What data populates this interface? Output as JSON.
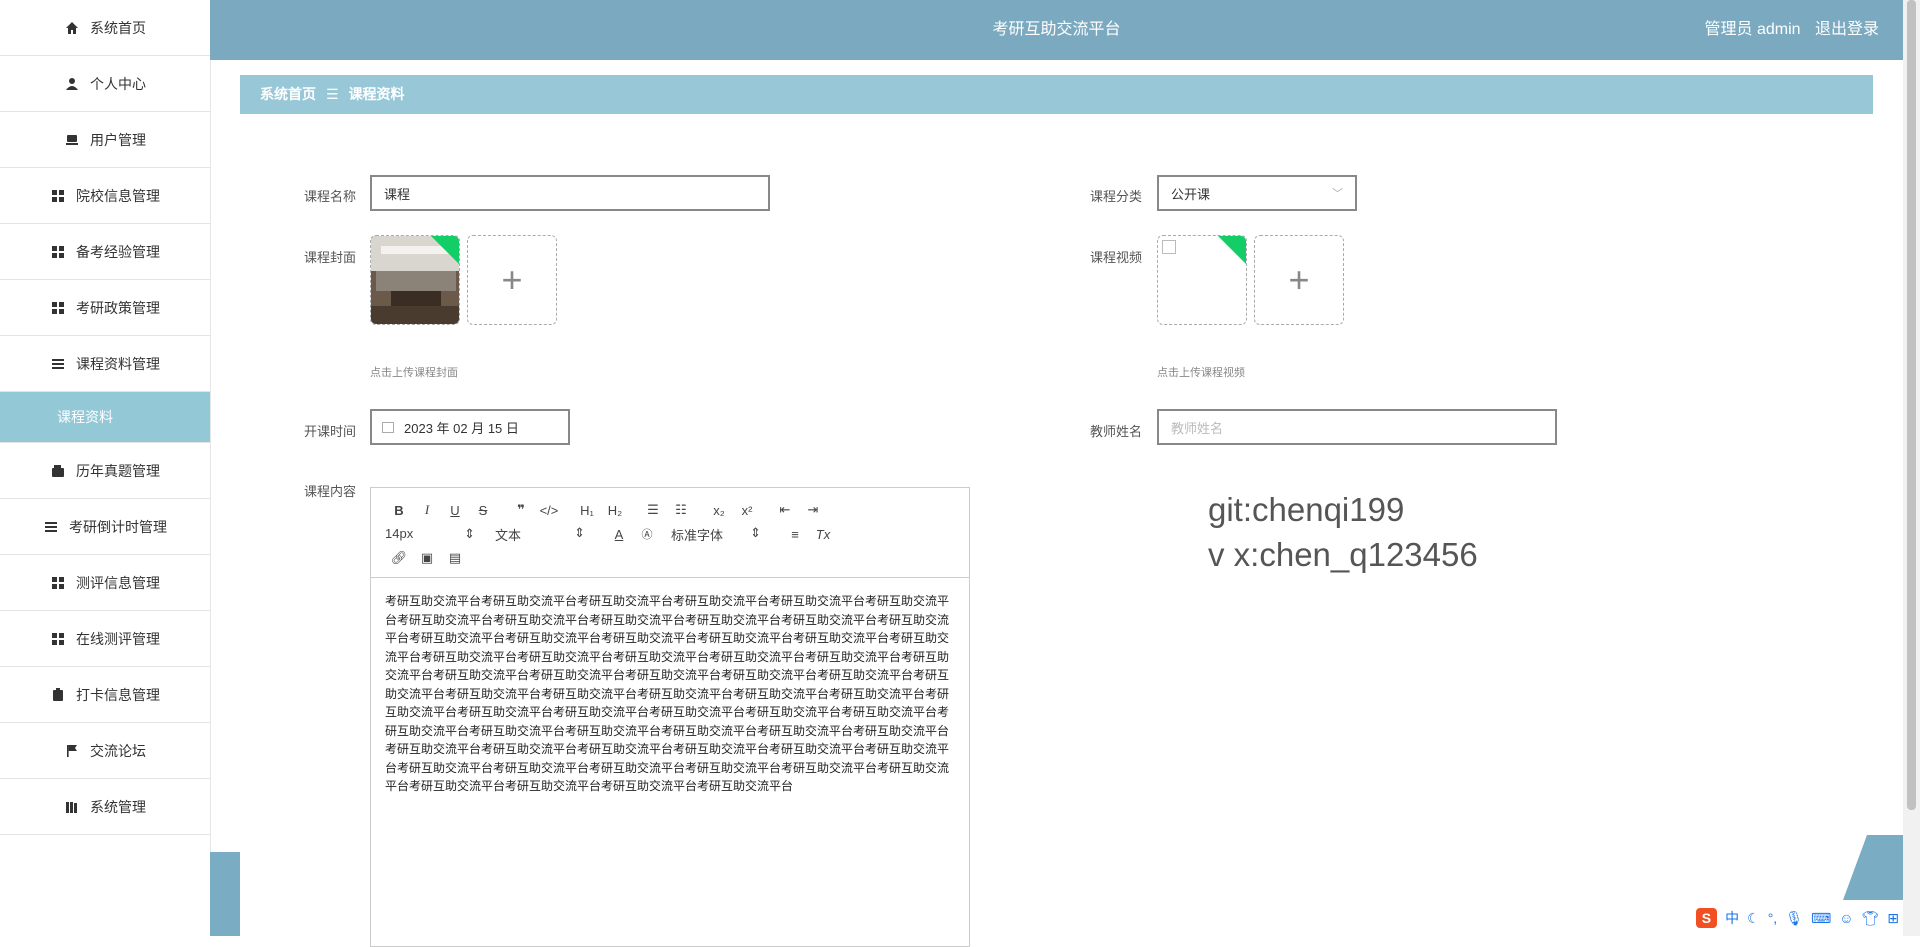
{
  "header": {
    "title": "考研互助交流平台",
    "user": "管理员 admin",
    "logout": "退出登录"
  },
  "sidebar": {
    "items": [
      {
        "label": "系统首页",
        "icon": "home-icon"
      },
      {
        "label": "个人中心",
        "icon": "user-icon"
      },
      {
        "label": "用户管理",
        "icon": "users-icon"
      },
      {
        "label": "院校信息管理",
        "icon": "grid-icon"
      },
      {
        "label": "备考经验管理",
        "icon": "grid-icon"
      },
      {
        "label": "考研政策管理",
        "icon": "grid-icon"
      },
      {
        "label": "课程资料管理",
        "icon": "list-icon"
      },
      {
        "label": "课程资料",
        "icon": "",
        "sub": true
      },
      {
        "label": "历年真题管理",
        "icon": "wallet-icon"
      },
      {
        "label": "考研倒计时管理",
        "icon": "list-icon"
      },
      {
        "label": "测评信息管理",
        "icon": "grid-icon"
      },
      {
        "label": "在线测评管理",
        "icon": "grid-icon"
      },
      {
        "label": "打卡信息管理",
        "icon": "clipboard-icon"
      },
      {
        "label": "交流论坛",
        "icon": "flag-icon"
      },
      {
        "label": "系统管理",
        "icon": "book-icon"
      }
    ]
  },
  "breadcrumb": {
    "home": "系统首页",
    "sep": "☰",
    "current": "课程资料"
  },
  "form": {
    "course_name_label": "课程名称",
    "course_name_value": "课程",
    "category_label": "课程分类",
    "category_value": "公开课",
    "cover_label": "课程封面",
    "cover_hint": "点击上传课程封面",
    "video_label": "课程视频",
    "video_hint": "点击上传课程视频",
    "date_label": "开课时间",
    "date_value": "2023 年 02 月 15 日",
    "teacher_label": "教师姓名",
    "teacher_placeholder": "教师姓名",
    "content_label": "课程内容"
  },
  "editor": {
    "font_size": "14px",
    "block": "文本",
    "font_family": "标准字体",
    "content": "考研互助交流平台考研互助交流平台考研互助交流平台考研互助交流平台考研互助交流平台考研互助交流平台考研互助交流平台考研互助交流平台考研互助交流平台考研互助交流平台考研互助交流平台考研互助交流平台考研互助交流平台考研互助交流平台考研互助交流平台考研互助交流平台考研互助交流平台考研互助交流平台考研互助交流平台考研互助交流平台考研互助交流平台考研互助交流平台考研互助交流平台考研互助交流平台考研互助交流平台考研互助交流平台考研互助交流平台考研互助交流平台考研互助交流平台考研互助交流平台考研互助交流平台考研互助交流平台考研互助交流平台考研互助交流平台考研互助交流平台考研互助交流平台考研互助交流平台考研互助交流平台考研互助交流平台考研互助交流平台考研互助交流平台考研互助交流平台考研互助交流平台考研互助交流平台考研互助交流平台考研互助交流平台考研互助交流平台考研互助交流平台考研互助交流平台考研互助交流平台考研互助交流平台考研互助交流平台考研互助交流平台考研互助交流平台考研互助交流平台考研互助交流平台考研互助交流平台考研互助交流平台考研互助交流平台考研互助交流平台考研互助交流平台考研互助交流平台考研互助交流平台"
  },
  "watermark": {
    "line1": "git:chenqi199",
    "line2": "v x:chen_q123456"
  },
  "ime": {
    "logo": "S",
    "mode": "中"
  },
  "colors": {
    "header": "#7aa9c0",
    "breadcrumb": "#98c8d8",
    "active": "#93c8d7",
    "corner": "#13ce66"
  }
}
